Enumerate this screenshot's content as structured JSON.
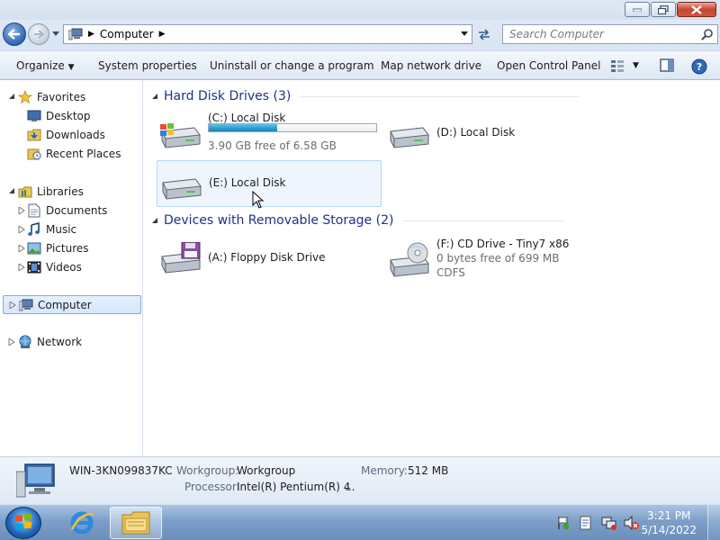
{
  "address": {
    "location": "Computer",
    "search_placeholder": "Search Computer"
  },
  "toolbar": {
    "organize": "Organize",
    "system_properties": "System properties",
    "uninstall": "Uninstall or change a program",
    "map_drive": "Map network drive",
    "control_panel": "Open Control Panel"
  },
  "nav": {
    "favorites": "Favorites",
    "desktop": "Desktop",
    "downloads": "Downloads",
    "recent_places": "Recent Places",
    "libraries": "Libraries",
    "documents": "Documents",
    "music": "Music",
    "pictures": "Pictures",
    "videos": "Videos",
    "computer": "Computer",
    "network": "Network"
  },
  "groups": {
    "hard_disks": "Hard Disk Drives (3)",
    "removable": "Devices with Removable Storage (2)"
  },
  "drives": {
    "c": {
      "name": "(C:) Local Disk",
      "free": "3.90 GB free of 6.58 GB",
      "used_fraction": 0.41
    },
    "d": {
      "name": "(D:) Local Disk"
    },
    "e": {
      "name": "(E:) Local Disk"
    },
    "a": {
      "name": "(A:) Floppy Disk Drive"
    },
    "f": {
      "name": "(F:) CD Drive - Tiny7 x86",
      "free": "0 bytes free of 699 MB",
      "fs": "CDFS"
    }
  },
  "details": {
    "computer_name": "WIN-3KN099837KC",
    "workgroup_label": "Workgroup:",
    "workgroup": "Workgroup",
    "memory_label": "Memory:",
    "memory": "512 MB",
    "processor_label": "Processor:",
    "processor": "Intel(R) Pentium(R) 4",
    "processor_more": "..."
  },
  "taskbar": {
    "time": "3:21 PM",
    "date": "5/14/2022"
  }
}
